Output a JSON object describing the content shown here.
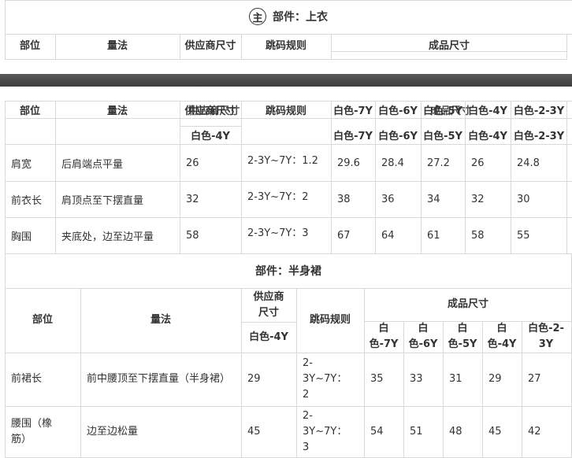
{
  "section1": {
    "badge": "主",
    "title": "部件：上衣",
    "header_cols": [
      "部位",
      "量法",
      "供应商尺寸",
      "跳码规则",
      "成品尺寸"
    ]
  },
  "table1": {
    "header_row1": {
      "part": "部位",
      "method": "量法",
      "supplier": "供应商尺寸",
      "rule": "跳码规则",
      "finished_overlay": "成品尺寸",
      "sizes": [
        "白色-7Y",
        "白色-6Y",
        "白色-5Y",
        "白色-4Y",
        "白色-2-3Y"
      ]
    },
    "supplier_size": "白色-4Y",
    "sizes": [
      "白色-7Y",
      "白色-6Y",
      "白色-5Y",
      "白色-4Y",
      "白色-2-3Y"
    ],
    "rows": [
      {
        "part": "肩宽",
        "method": "后肩端点平量",
        "supplier": "26",
        "rule": "2-3Y~7Y：1.2",
        "values": [
          "29.6",
          "28.4",
          "27.2",
          "26",
          "24.8"
        ]
      },
      {
        "part": "前衣长",
        "method": "肩顶点至下摆直量",
        "supplier": "32",
        "rule": "2-3Y~7Y：2",
        "values": [
          "38",
          "36",
          "34",
          "32",
          "30"
        ]
      },
      {
        "part": "胸围",
        "method": "夹底处，边至边平量",
        "supplier": "58",
        "rule": "2-3Y~7Y：3",
        "values": [
          "67",
          "64",
          "61",
          "58",
          "55"
        ]
      }
    ]
  },
  "section2": {
    "title": "部件：半身裙"
  },
  "table2": {
    "part": "部位",
    "method": "量法",
    "supplier": "供应商尺寸",
    "rule": "跳码规则",
    "finished": "成品尺寸",
    "supplier_size": "白色-4Y",
    "sizes": [
      "白色-7Y",
      "白色-6Y",
      "白色-5Y",
      "白色-4Y",
      "白色-2-3Y"
    ],
    "rows": [
      {
        "part": "前裙长",
        "method": "前中腰顶至下摆直量（半身裙）",
        "supplier": "29",
        "rule": "2-3Y~7Y：2",
        "values": [
          "35",
          "33",
          "31",
          "29",
          "27"
        ]
      },
      {
        "part": "腰围（橡筋）",
        "method": "边至边松量",
        "supplier": "45",
        "rule": "2-3Y~7Y：3",
        "values": [
          "54",
          "51",
          "48",
          "45",
          "42"
        ]
      }
    ]
  }
}
